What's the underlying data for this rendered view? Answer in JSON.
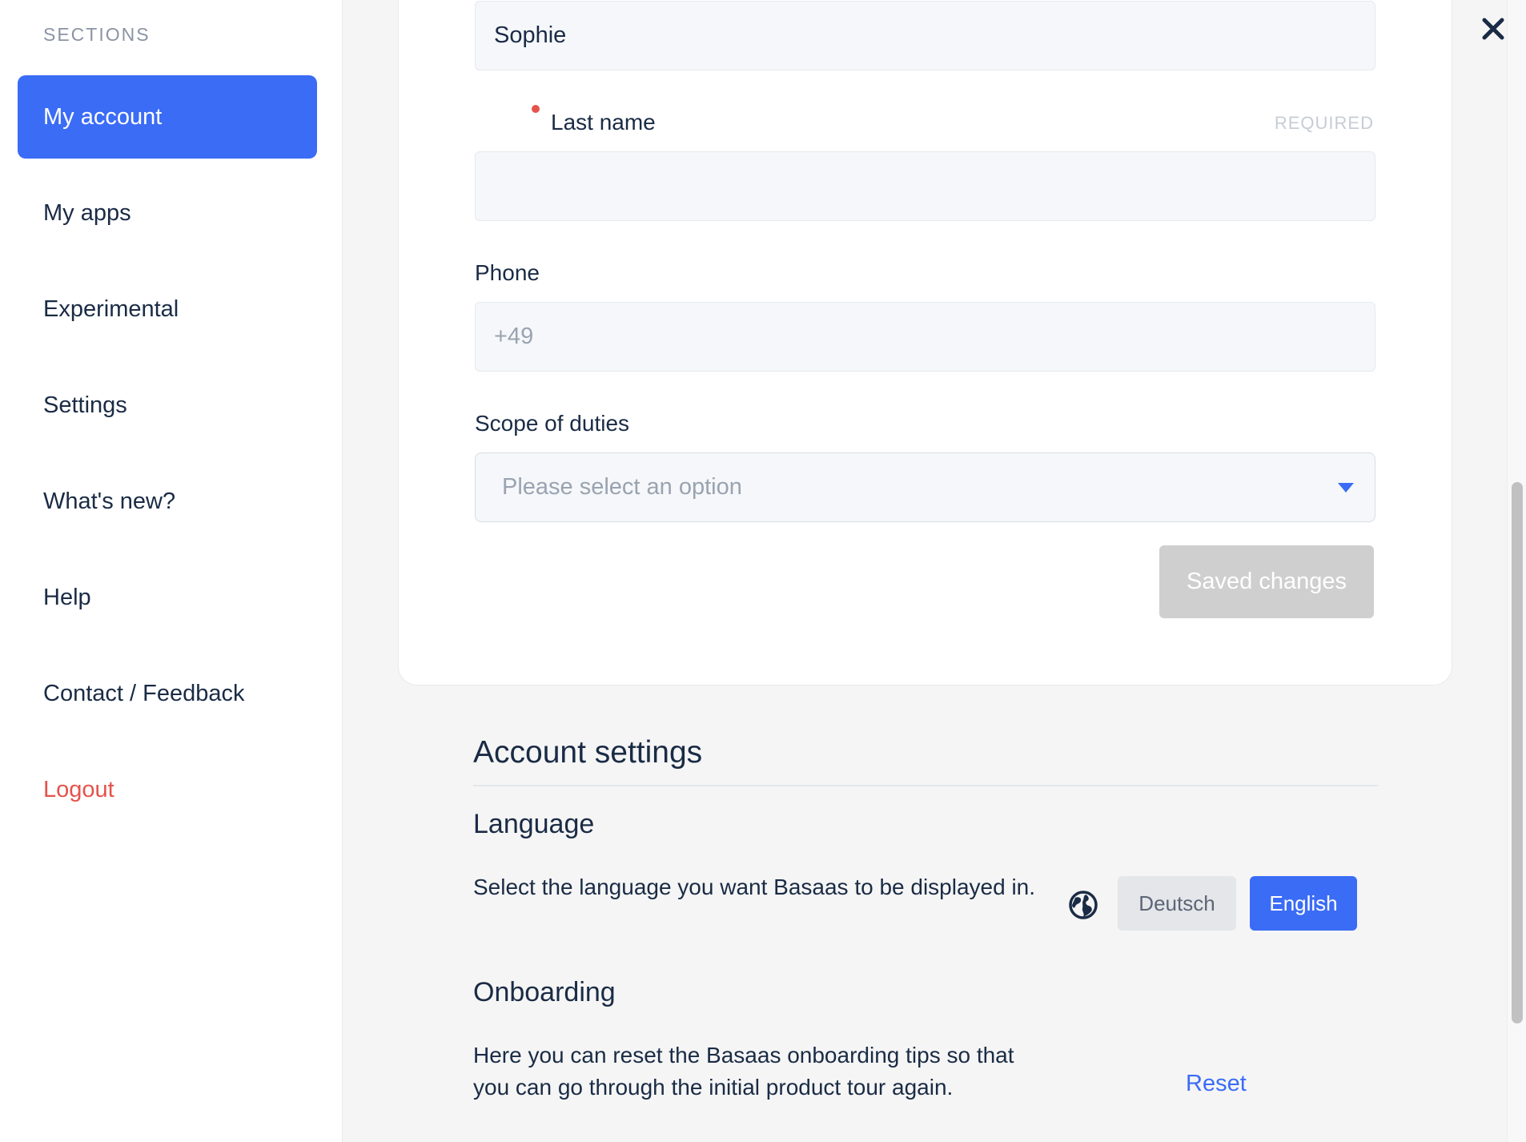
{
  "sidebar": {
    "heading": "SECTIONS",
    "items": [
      {
        "label": "My account"
      },
      {
        "label": "My apps"
      },
      {
        "label": "Experimental"
      },
      {
        "label": "Settings"
      },
      {
        "label": "What's new?"
      },
      {
        "label": "Help"
      },
      {
        "label": "Contact / Feedback"
      },
      {
        "label": "Logout"
      }
    ]
  },
  "form": {
    "first_name_value": "Sophie",
    "last_name_label": "Last name",
    "required_text": "REQUIRED",
    "last_name_value": "",
    "phone_label": "Phone",
    "phone_value": "+49",
    "scope_label": "Scope of duties",
    "scope_placeholder": "Please select an option",
    "save_label": "Saved changes"
  },
  "account_settings": {
    "title": "Account settings",
    "language": {
      "title": "Language",
      "description": "Select the language you want Basaas to be displayed in.",
      "options": [
        "Deutsch",
        "English"
      ],
      "selected": "English"
    },
    "onboarding": {
      "title": "Onboarding",
      "description": "Here you can reset the Basaas onboarding tips so that you can go through the initial product tour again.",
      "reset_label": "Reset"
    }
  },
  "colors": {
    "accent": "#3b6cf6",
    "logout": "#e5534b",
    "text": "#1a2b45",
    "disabled_button": "#cfcfcf"
  },
  "icons": {
    "close": "close-icon",
    "globe": "globe-icon",
    "dropdown": "chevron-down-icon"
  }
}
